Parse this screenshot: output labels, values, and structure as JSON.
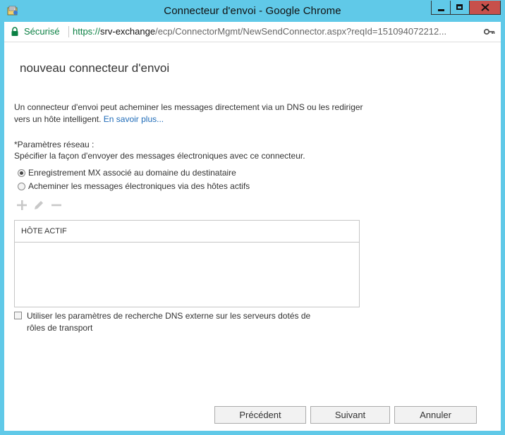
{
  "window": {
    "title": "Connecteur d'envoi - Google Chrome"
  },
  "addressbar": {
    "secure_label": "Sécurisé",
    "url_scheme": "https://",
    "url_host": "srv-exchange",
    "url_path": "/ecp/ConnectorMgmt/NewSendConnector.aspx?reqId=151094072212..."
  },
  "page": {
    "heading": "nouveau connecteur d'envoi",
    "description": "Un connecteur d'envoi peut acheminer les messages directement via un DNS ou les rediriger vers un hôte intelligent.",
    "learn_more": "En savoir plus...",
    "network_label": "*Paramètres réseau :",
    "network_sub": "Spécifier la façon d'envoyer des messages électroniques avec ce connecteur.",
    "radio_options": [
      {
        "label": "Enregistrement MX associé au domaine du destinataire",
        "checked": true
      },
      {
        "label": "Acheminer les messages électroniques via des hôtes actifs",
        "checked": false
      }
    ],
    "table": {
      "column_header": "HÔTE ACTIF"
    },
    "external_dns_label": "Utiliser les paramètres de recherche DNS externe sur les serveurs dotés de rôles de transport",
    "external_dns_checked": false
  },
  "buttons": {
    "previous": "Précédent",
    "next": "Suivant",
    "cancel": "Annuler"
  },
  "colors": {
    "titlebar": "#60c9e8",
    "close_button": "#c7504b",
    "secure_green": "#0b8043",
    "link_blue": "#1e6bb8"
  }
}
